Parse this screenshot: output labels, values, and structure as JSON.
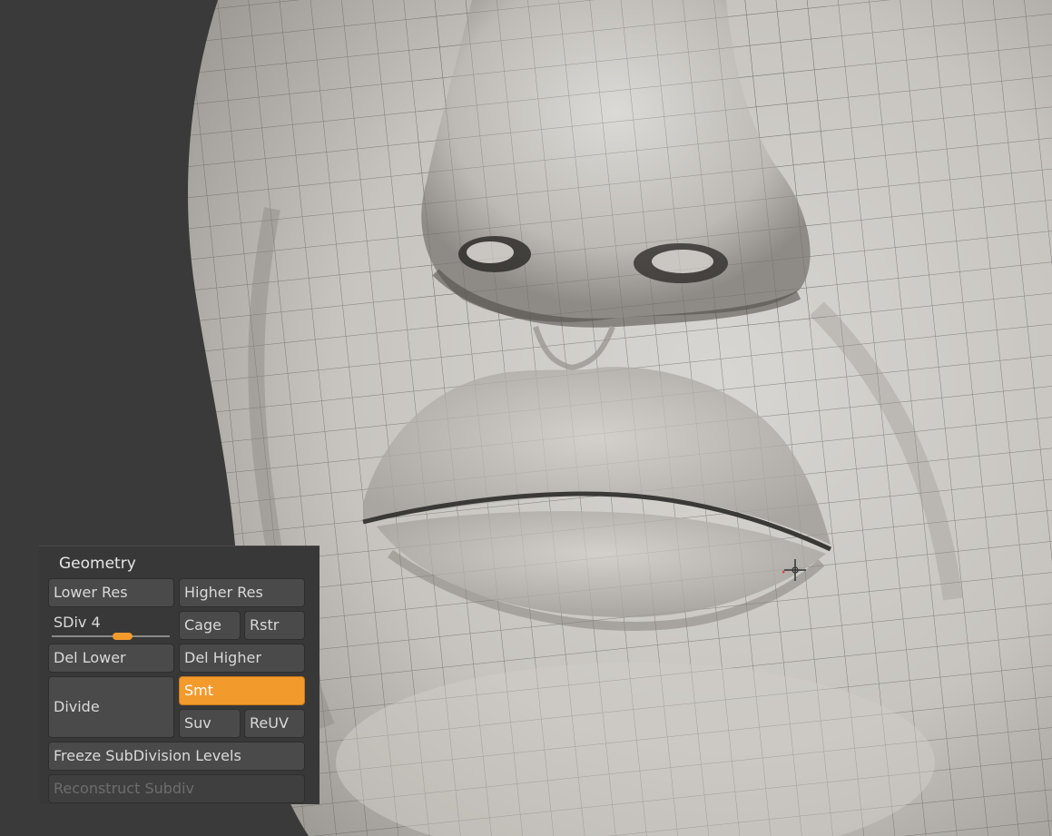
{
  "viewport": {
    "name": "3D sculpt viewport",
    "mesh": "face close-up with polygon wireframe",
    "cursor": "crosshair-cursor-icon"
  },
  "panel": {
    "title": "Geometry",
    "buttons": {
      "lower_res": "Lower Res",
      "higher_res": "Higher Res",
      "sdiv": "SDiv 4",
      "cage": "Cage",
      "rstr": "Rstr",
      "del_lower": "Del Lower",
      "del_higher": "Del Higher",
      "divide": "Divide",
      "smt": "Smt",
      "suv": "Suv",
      "reuv": "ReUV",
      "freeze": "Freeze SubDivision Levels",
      "reconstruct": "Reconstruct Subdiv"
    },
    "sdiv_level_fraction": 0.6,
    "smt_active": true,
    "reconstruct_disabled": true
  },
  "colors": {
    "accent": "#f39a2c",
    "panel_bg": "#383838",
    "button_bg": "#4a4a4a",
    "viewport_bg": "#3a3a3a"
  }
}
